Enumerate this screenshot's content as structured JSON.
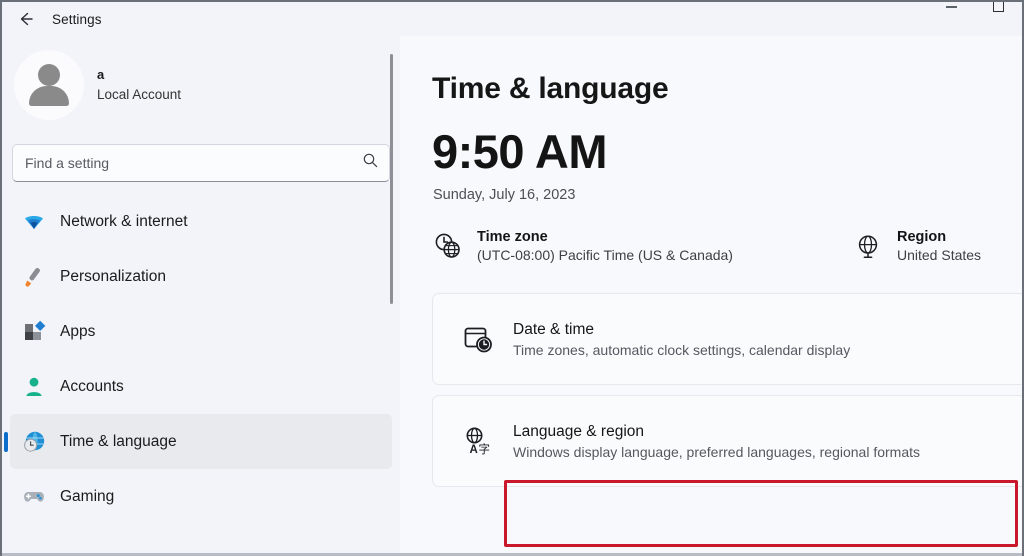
{
  "window": {
    "app_title": "Settings",
    "back_icon": "back-arrow-icon",
    "minimize_label": "Minimize",
    "maximize_label": "Maximize"
  },
  "sidebar": {
    "account": {
      "name": "a",
      "type": "Local Account",
      "avatar_icon": "person-avatar-icon"
    },
    "search": {
      "placeholder": "Find a setting",
      "value": "",
      "icon": "search-icon"
    },
    "items": [
      {
        "label": "Network & internet",
        "icon": "wifi-icon",
        "selected": false
      },
      {
        "label": "Personalization",
        "icon": "paintbrush-icon",
        "selected": false
      },
      {
        "label": "Apps",
        "icon": "apps-grid-icon",
        "selected": false
      },
      {
        "label": "Accounts",
        "icon": "person-icon",
        "selected": false
      },
      {
        "label": "Time & language",
        "icon": "clock-globe-icon",
        "selected": true
      },
      {
        "label": "Gaming",
        "icon": "gamepad-icon",
        "selected": false
      }
    ]
  },
  "main": {
    "page_title": "Time & language",
    "clock": {
      "time": "9:50 AM",
      "date": "Sunday, July 16, 2023"
    },
    "info": [
      {
        "title": "Time zone",
        "value": "(UTC-08:00) Pacific Time (US & Canada)",
        "icon": "clock-globe-icon"
      },
      {
        "title": "Region",
        "value": "United States",
        "icon": "globe-icon"
      }
    ],
    "cards": [
      {
        "title": "Date & time",
        "subtitle": "Time zones, automatic clock settings, calendar display",
        "icon": "calendar-clock-icon",
        "highlighted": false
      },
      {
        "title": "Language & region",
        "subtitle": "Windows display language, preferred languages, regional formats",
        "icon": "language-translate-icon",
        "highlighted": true
      }
    ]
  },
  "annotation": {
    "highlight_color": "#c9182b",
    "target": "Language & region"
  },
  "colors": {
    "accent": "#0d6ecd",
    "sidebar_bg": "#f2f4fa",
    "content_bg": "#f7f9fd",
    "card_bg": "#fafbfd",
    "selected_item_bg": "#e9eaee"
  }
}
